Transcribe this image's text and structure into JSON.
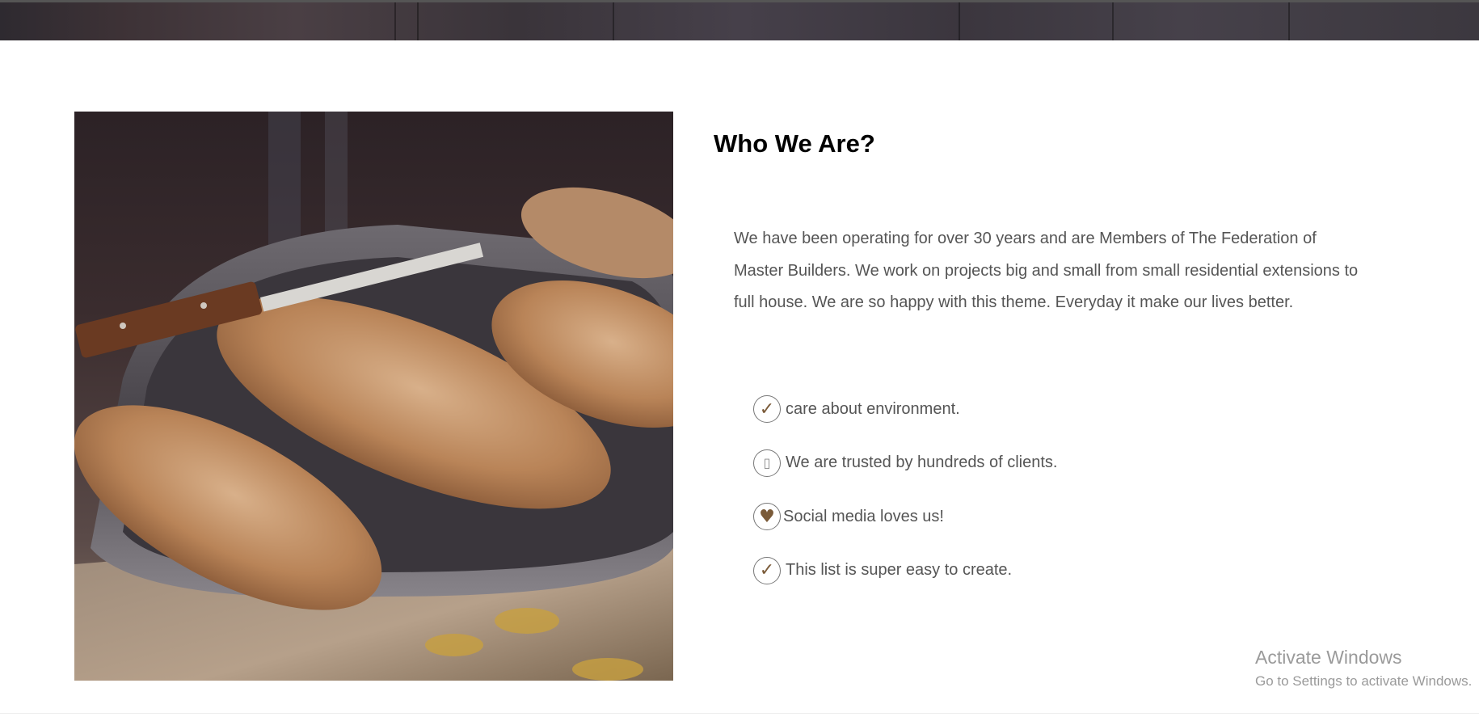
{
  "section": {
    "heading": "Who We Are?",
    "intro": "We have been operating for over 30 years and are Members of The Federation of Master Builders. We work on projects big and small from small residential extensions to full house. We are so happy with this theme. Everyday it make our lives better.",
    "features": [
      {
        "icon": "checkmark-icon",
        "glyph": "✓",
        "text": "care about environment."
      },
      {
        "icon": "missing-glyph-icon",
        "glyph": "▯",
        "text": " We are trusted by hundreds of clients."
      },
      {
        "icon": "heart-icon",
        "glyph": "♥",
        "text": "Social media loves us!"
      },
      {
        "icon": "checkmark-icon",
        "glyph": "✓",
        "text": " This list is super easy to create."
      }
    ]
  },
  "watermark": {
    "title": "Activate Windows",
    "subtitle": "Go to Settings to activate Windows."
  },
  "colors": {
    "icon_accent": "#7a5a38",
    "body_text": "#555555",
    "heading_text": "#000000"
  }
}
